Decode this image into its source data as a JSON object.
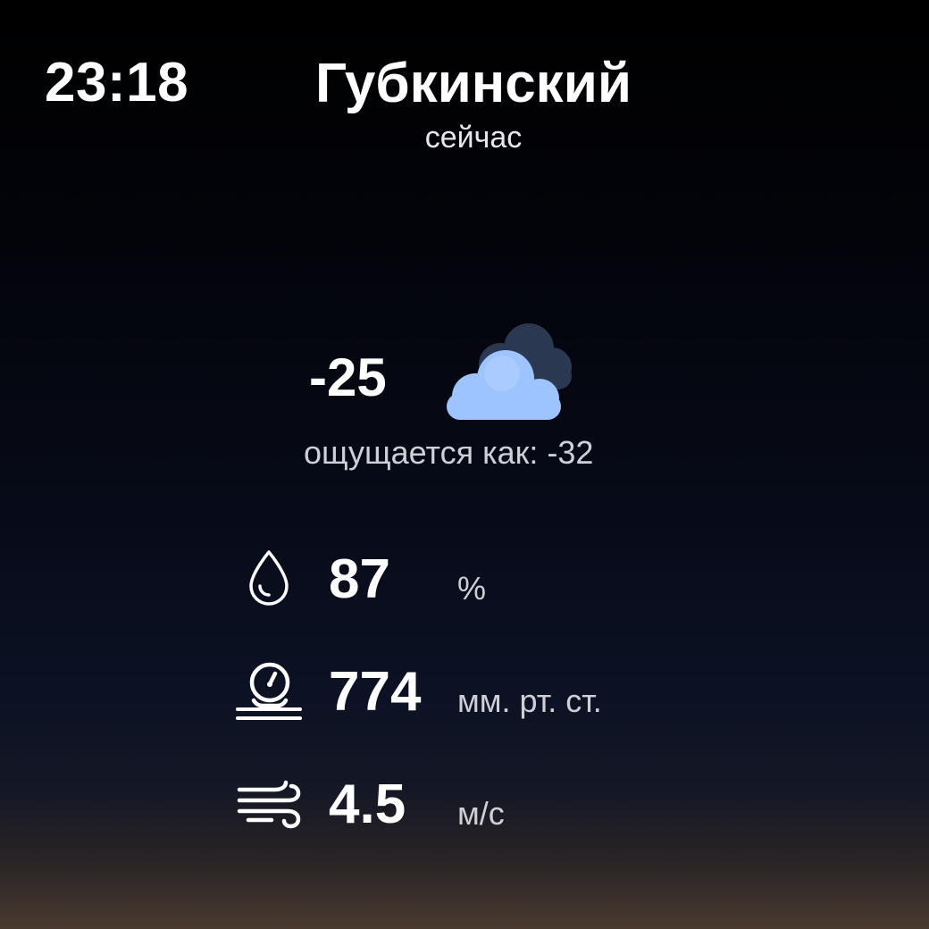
{
  "status": {
    "time": "23:18"
  },
  "location": {
    "city": "Губкинский",
    "period": "сейчас"
  },
  "current": {
    "temperature": "-25",
    "condition_icon": "partly-cloudy-night-icon",
    "feels_like": "ощущается как: -32"
  },
  "stats": {
    "humidity": {
      "icon": "water-drop-icon",
      "value": "87",
      "unit": "%"
    },
    "pressure": {
      "icon": "barometer-icon",
      "value": "774",
      "unit": "мм. рт. ст."
    },
    "wind": {
      "icon": "wind-icon",
      "value": "4.5",
      "unit": "м/с"
    }
  },
  "colors": {
    "text": "#ffffff",
    "secondary_text": "#cfd0d6",
    "cloud_front": "#9ec4ff",
    "cloud_back": "#2b3852"
  }
}
